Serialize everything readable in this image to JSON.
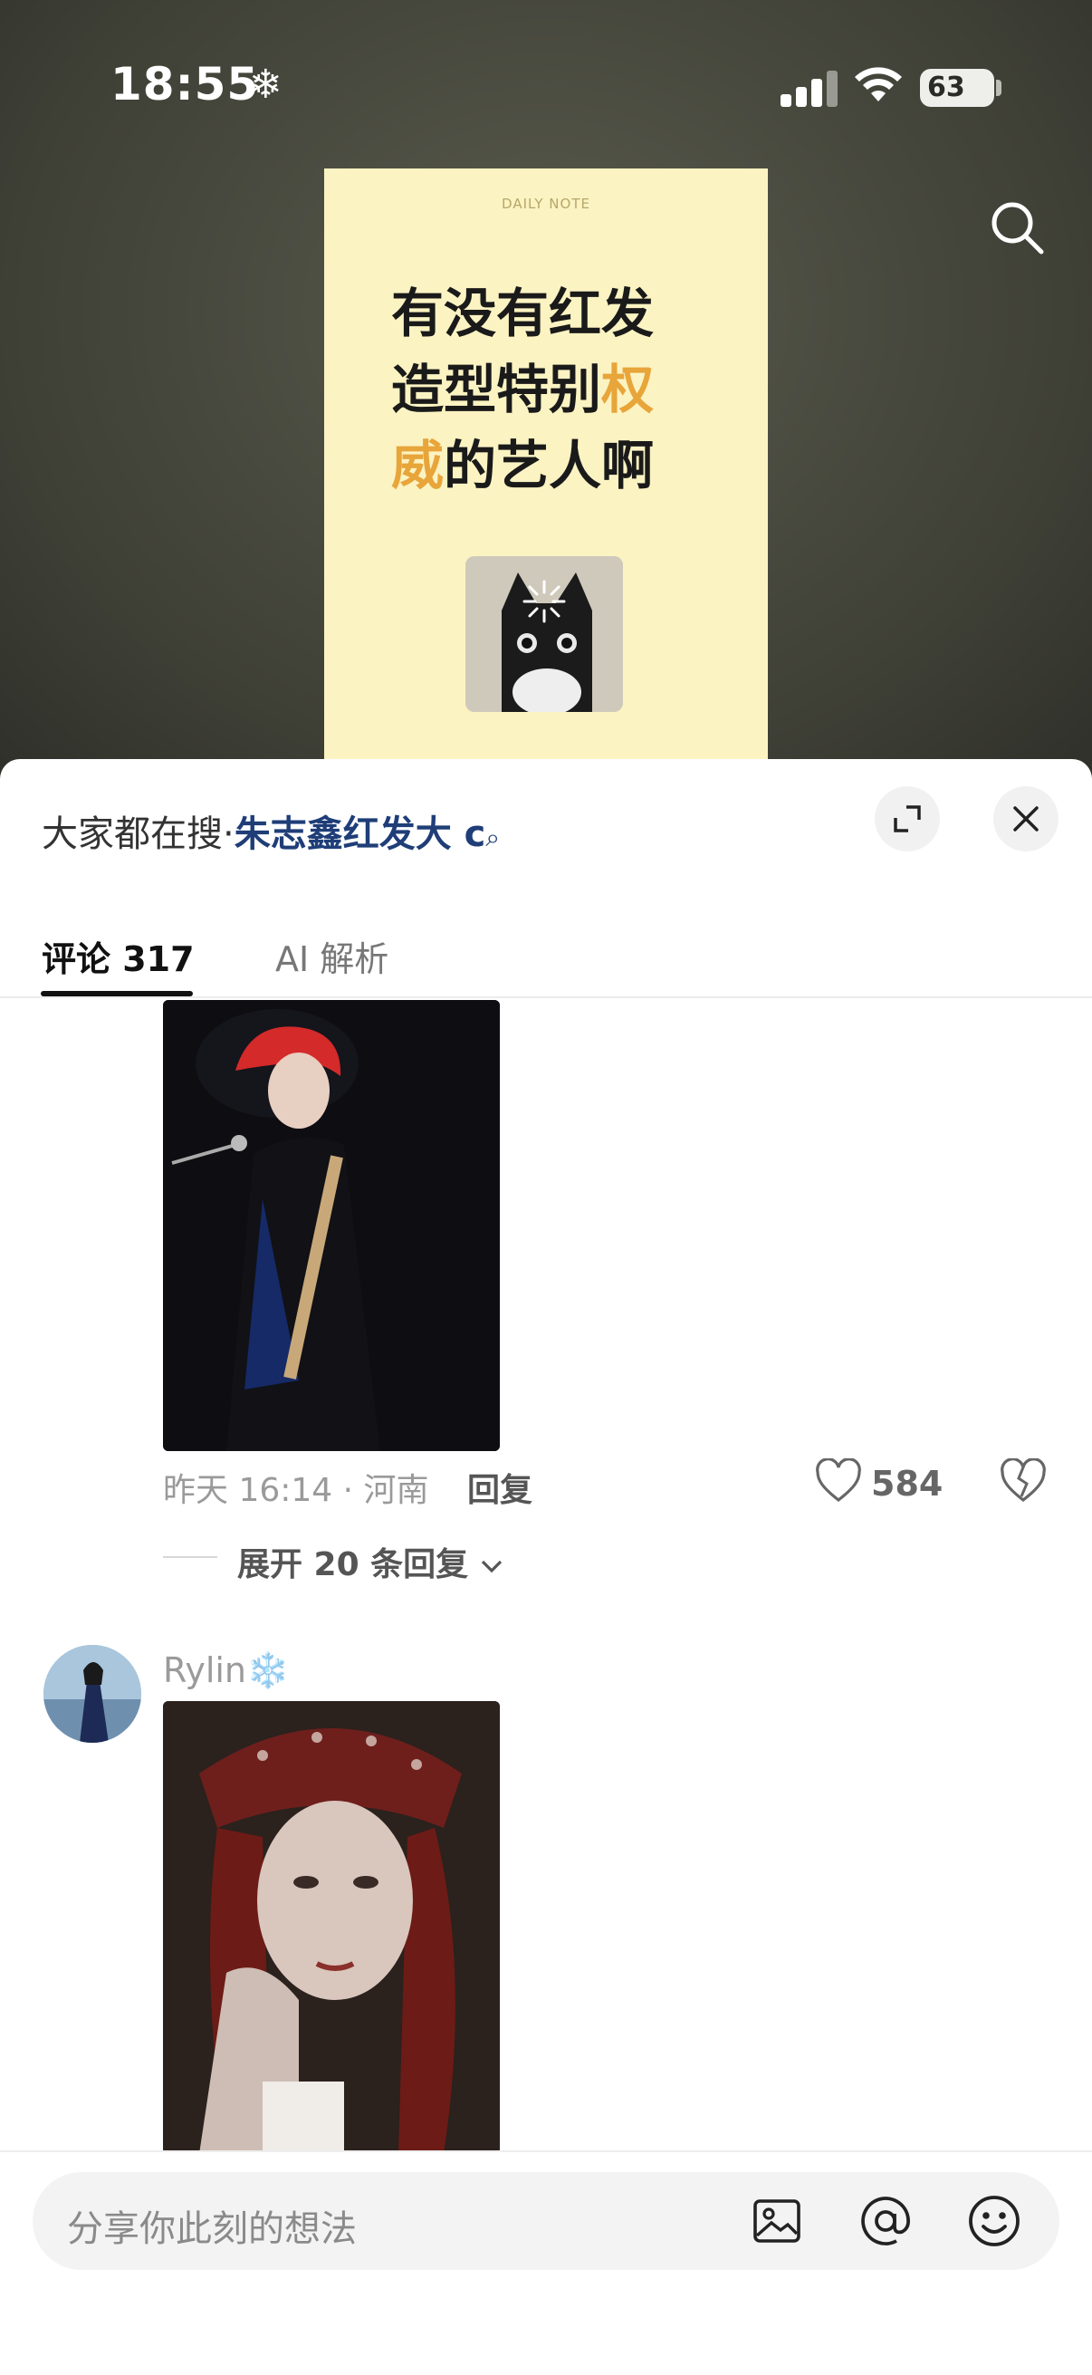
{
  "status_bar": {
    "time": "18:55",
    "weather_glyph": "❄",
    "battery": "63"
  },
  "poster": {
    "label": "DAILY NOTE",
    "line1": "有没有红发",
    "line2_a": "造型特别",
    "line2_b": "权",
    "line3_a": "威",
    "line3_b": "的艺人啊",
    "accent": "#e8a53a"
  },
  "sheet": {
    "hot_search_label": "大家都在搜·",
    "hot_search_keyword": "朱志鑫红发大 c",
    "hot_search_icon": "search-icon"
  },
  "tabs": [
    {
      "label": "评论 317",
      "active": true
    },
    {
      "label": "AI 解析",
      "active": false
    }
  ],
  "comment1": {
    "meta": "昨天 16:14 · 河南",
    "reply": "回复",
    "likes": "584",
    "expand": "展开 20 条回复"
  },
  "comment2": {
    "username": "Rylin",
    "username_emoji": "❄️"
  },
  "input": {
    "placeholder": "分享你此刻的想法"
  },
  "icons": [
    "search-icon",
    "expand-icon",
    "close-icon",
    "heart-icon",
    "broken-heart-icon",
    "image-icon",
    "at-icon",
    "emoji-icon"
  ]
}
